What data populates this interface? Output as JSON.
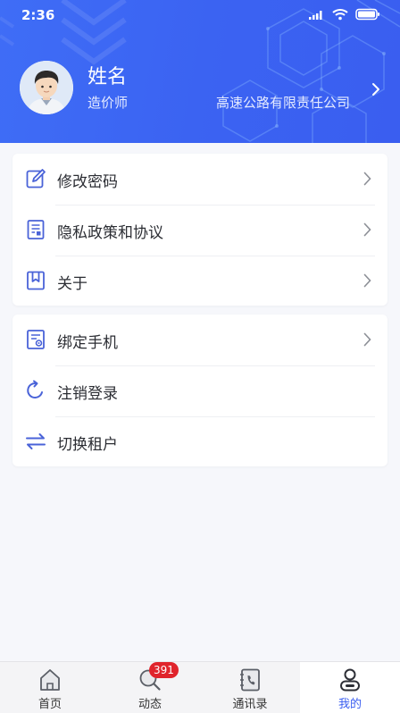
{
  "status_bar": {
    "time": "2:36"
  },
  "profile": {
    "name": "姓名",
    "role": "造价师",
    "company": "高速公路有限责任公司"
  },
  "menu_group_1": [
    {
      "label": "修改密码",
      "icon": "edit-icon"
    },
    {
      "label": "隐私政策和协议",
      "icon": "document-icon"
    },
    {
      "label": "关于",
      "icon": "bookmark-icon"
    }
  ],
  "menu_group_2": [
    {
      "label": "绑定手机",
      "icon": "certificate-icon"
    },
    {
      "label": "注销登录",
      "icon": "refresh-icon"
    },
    {
      "label": "切换租户",
      "icon": "swap-icon"
    }
  ],
  "tabs": [
    {
      "label": "首页",
      "icon": "home-icon"
    },
    {
      "label": "动态",
      "icon": "search-icon",
      "badge": "391"
    },
    {
      "label": "通讯录",
      "icon": "contacts-icon"
    },
    {
      "label": "我的",
      "icon": "user-icon",
      "active": true
    }
  ],
  "colors": {
    "primary": "#3a5ef0",
    "badge": "#e0242c",
    "text": "#2b2d33"
  }
}
